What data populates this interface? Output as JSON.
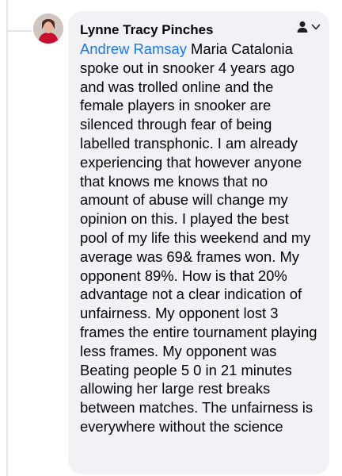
{
  "comment": {
    "author": "Lynne Tracy Pinches",
    "mention": "Andrew Ramsay",
    "body": " Maria Catalonia spoke out in snooker 4 years ago and was trolled online and the female players in snooker are silenced through fear of being labelled transphonic. I am already experiencing that however anyone that knows me knows that no amount of abuse will change my opinion on this. I played the best pool of my life this weekend and my average was 69& frames won. My opponent 89%. How is that 20% advantage not a clear indication of unfairness. My opponent lost 3 frames the entire tournament playing less frames. My opponent was Beating people 5 0 in 21 minutes allowing her large rest breaks between matches. The unfairness is everywhere without the science"
  },
  "icons": {
    "audience": "person-icon",
    "dropdown": "chevron-down-icon"
  },
  "colors": {
    "bubble": "#f0f2f5",
    "mention": "#1877f2",
    "text": "#050505"
  }
}
